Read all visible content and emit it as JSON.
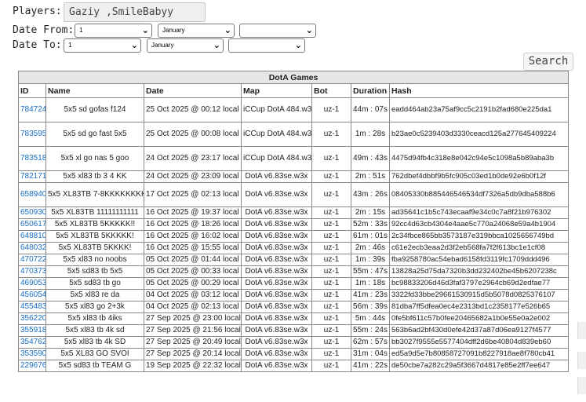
{
  "form": {
    "players_label": "Players:",
    "players_value": "Gaziy ,SmileBabyy",
    "date_from_label": "Date From:",
    "date_to_label": "Date To:",
    "from_day": "1",
    "from_month": "January",
    "from_year": "",
    "to_day": "1",
    "to_month": "January",
    "to_year": "",
    "search_label": "Search"
  },
  "table": {
    "caption": "DotA Games",
    "columns": [
      "ID",
      "Name",
      "Date",
      "Map",
      "Bot",
      "Duration",
      "Hash"
    ],
    "rows": [
      {
        "id": "784724",
        "name": "5x5 sd gofas f124",
        "date": "25 Oct 2025 @ 00:12 local",
        "map": "iCCup DotA 484.w3x",
        "bot": "uz-1",
        "duration": "44m : 07s",
        "hash": "eadd464ab23a75af9cc5c2191b2fad680e225da1",
        "tall": true
      },
      {
        "id": "783595",
        "name": "5x5 sd go fast 5x5",
        "date": "25 Oct 2025 @ 00:08 local",
        "map": "iCCup DotA 484.w3x",
        "bot": "uz-1",
        "duration": "1m : 28s",
        "hash": "b23ae0c5239403d3330ceacd125a277645409224",
        "tall": true
      },
      {
        "id": "783518",
        "name": "5x5 xl go nas 5 goo",
        "date": "24 Oct 2025 @ 23:17 local",
        "map": "iCCup DotA 484.w3x",
        "bot": "uz-1",
        "duration": "49m : 43s",
        "hash": "4475d94fb4c318e8e042c94e5c1098a5b89aba3b",
        "tall": true
      },
      {
        "id": "782171",
        "name": "5x5 xl83 tb 3 4 KK",
        "date": "24 Oct 2025 @ 23:09 local",
        "map": "DotA v6.83se.w3x",
        "bot": "uz-1",
        "duration": "2m : 51s",
        "hash": "762dbef4dbbf9b5fc905c03ed1b0de92e6b0f12f",
        "tall": false
      },
      {
        "id": "658940",
        "name": "5x5 XL83TB 7-8KKKKKKKK!",
        "date": "17 Oct 2025 @ 02:13 local",
        "map": "DotA v6.83se.w3x",
        "bot": "uz-1",
        "duration": "43m : 26s",
        "hash": "08405330b885446546534df7326a5db9dba588b6",
        "tall": true
      },
      {
        "id": "650930",
        "name": "5x5 XL83TB 11111111111",
        "date": "16 Oct 2025 @ 19:37 local",
        "map": "DotA v6.83se.w3x",
        "bot": "uz-1",
        "duration": "2m : 15s",
        "hash": "ad35641c1b5c743ecaaf9e34c0c7a8f21b976302",
        "tall": false
      },
      {
        "id": "650617",
        "name": "5x5 XL83TB 5KKKKK!!",
        "date": "16 Oct 2025 @ 18:26 local",
        "map": "DotA v6.83se.w3x",
        "bot": "uz-1",
        "duration": "52m : 33s",
        "hash": "92cc4d63cb4304e4aae5c770a24068e59a4b1904",
        "tall": false
      },
      {
        "id": "648810",
        "name": "5x5 XL83TB 5KKKKK!",
        "date": "16 Oct 2025 @ 16:02 local",
        "map": "DotA v6.83se.w3x",
        "bot": "uz-1",
        "duration": "61m : 01s",
        "hash": "2c34fbce865bb3573187e319bbca1025656749bd",
        "tall": false
      },
      {
        "id": "648032",
        "name": "5x5 XL83TB 5KKKK!",
        "date": "16 Oct 2025 @ 15:55 local",
        "map": "DotA v6.83se.w3x",
        "bot": "uz-1",
        "duration": "2m : 46s",
        "hash": "c61e2ecb3eaa2d3f2eb568fa7f2f613bc1e1cf08",
        "tall": false
      },
      {
        "id": "470722",
        "name": "5x5 xl83 no noobs",
        "date": "05 Oct 2025 @ 01:44 local",
        "map": "DotA v6.83se.w3x",
        "bot": "uz-1",
        "duration": "1m : 39s",
        "hash": "fba9258780ac54ebad6158fd3119fc1709ddd496",
        "tall": false
      },
      {
        "id": "470373",
        "name": "5x5 sd83 tb 5x5",
        "date": "05 Oct 2025 @ 00:33 local",
        "map": "DotA v6.83se.w3x",
        "bot": "uz-1",
        "duration": "55m : 47s",
        "hash": "13828a25d75da7320b3dd232402be45b6207238c",
        "tall": false
      },
      {
        "id": "469053",
        "name": "5x5 sd83 tb go",
        "date": "05 Oct 2025 @ 00:29 local",
        "map": "DotA v6.83se.w3x",
        "bot": "uz-1",
        "duration": "1m : 18s",
        "hash": "bc98833206d46d3faf3797e2964cb69d2edfae77",
        "tall": false
      },
      {
        "id": "456054",
        "name": "5x5 xl83 re da",
        "date": "04 Oct 2025 @ 03:12 local",
        "map": "DotA v6.83se.w3x",
        "bot": "uz-1",
        "duration": "41m : 23s",
        "hash": "3322fd33bbe29661530915d5b5078d0825376107",
        "tall": false
      },
      {
        "id": "455483",
        "name": "5x5 xl83 go 2+3k",
        "date": "04 Oct 2025 @ 02:13 local",
        "map": "DotA v6.83se.w3x",
        "bot": "uz-1",
        "duration": "56m : 39s",
        "hash": "81dba7ff5dfea0ec4e2313bd1c2358177e526b65",
        "tall": false
      },
      {
        "id": "356220",
        "name": "5x5 xl83 tb 4iks",
        "date": "27 Sep 2025 @ 23:00 local",
        "map": "DotA v6.83se.w3x",
        "bot": "uz-1",
        "duration": "5m : 44s",
        "hash": "0fe5bf611c57b0fee20465682a1b0e55e0a2e002",
        "tall": false
      },
      {
        "id": "355918",
        "name": "5x5 xl83 tb 4k sd",
        "date": "27 Sep 2025 @ 21:56 local",
        "map": "DotA v6.83se.w3x",
        "bot": "uz-1",
        "duration": "55m : 24s",
        "hash": "563b6ad2bf430d0efe42d37a87d06ea9127f4577",
        "tall": false
      },
      {
        "id": "354762",
        "name": "5x5 xl83 tb 4k SD",
        "date": "27 Sep 2025 @ 20:49 local",
        "map": "DotA v6.83se.w3x",
        "bot": "uz-1",
        "duration": "62m : 57s",
        "hash": "bb3027f9555e5577404dff2d6be40804d839eb60",
        "tall": false
      },
      {
        "id": "353590",
        "name": "5x5 XL83 GO SVOI",
        "date": "27 Sep 2025 @ 20:14 local",
        "map": "DotA v6.83se.w3x",
        "bot": "uz-1",
        "duration": "31m : 04s",
        "hash": "ed5a9d5e7b80858727091b8227918ae8f780cb41",
        "tall": false
      },
      {
        "id": "229676",
        "name": "5x5 sd83 tb TEAM G",
        "date": "19 Sep 2025 @ 22:32 local",
        "map": "DotA v6.83se.w3x",
        "bot": "uz-1",
        "duration": "41m : 22s",
        "hash": "de50cbe7a282c29a5f3667d4817e85e2ff7ee647",
        "tall": false
      }
    ]
  }
}
